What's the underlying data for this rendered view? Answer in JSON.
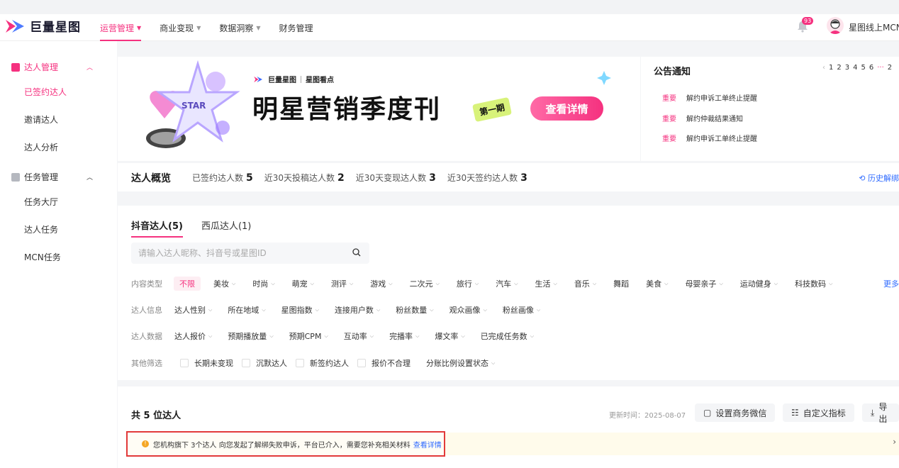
{
  "app": {
    "logo_text": "巨量星图"
  },
  "nav": [
    {
      "label": "运营管理",
      "active": true,
      "dropdown": true
    },
    {
      "label": "商业变现",
      "dropdown": true
    },
    {
      "label": "数据洞察",
      "dropdown": true
    },
    {
      "label": "财务管理",
      "dropdown": false
    }
  ],
  "header": {
    "notification_count": "93",
    "username": "星图线上MCN"
  },
  "sidebar": {
    "groups": [
      {
        "label": "达人管理",
        "items": [
          "已签约达人",
          "邀请达人",
          "达人分析"
        ]
      },
      {
        "label": "任务管理",
        "items": [
          "任务大厅",
          "达人任务",
          "MCN任务"
        ]
      }
    ]
  },
  "banner": {
    "brand": "巨量星图",
    "subbrand": "星图看点",
    "title": "明星营销季度刊",
    "tag": "第一期",
    "star": "STAR",
    "cta": "查看详情"
  },
  "notice": {
    "title": "公告通知",
    "pages": [
      "1",
      "2",
      "3",
      "4",
      "5",
      "6",
      "···",
      "2"
    ],
    "items": [
      {
        "tag": "重要",
        "text": "解约申诉工单终止提醒"
      },
      {
        "tag": "重要",
        "text": "解约仲裁结果通知"
      },
      {
        "tag": "重要",
        "text": "解约申诉工单终止提醒"
      }
    ]
  },
  "overview": {
    "title": "达人概览",
    "stats": [
      {
        "label": "已签约达人数",
        "value": "5"
      },
      {
        "label": "近30天投稿达人数",
        "value": "2"
      },
      {
        "label": "近30天变现达人数",
        "value": "3"
      },
      {
        "label": "近30天签约达人数",
        "value": "3"
      }
    ],
    "history": "历史解绑"
  },
  "tabs": [
    "抖音达人(5)",
    "西瓜达人(1)"
  ],
  "search": {
    "placeholder": "请输入达人昵称、抖音号或星图ID",
    "value": ""
  },
  "filters": {
    "content": {
      "label": "内容类型",
      "options": [
        "不限",
        "美妆",
        "时尚",
        "萌宠",
        "测评",
        "游戏",
        "二次元",
        "旅行",
        "汽车",
        "生活",
        "音乐",
        "舞蹈",
        "美食",
        "母婴亲子",
        "运动健身",
        "科技数码"
      ],
      "more": "更多"
    },
    "info": {
      "label": "达人信息",
      "options": [
        "达人性别",
        "所在地域",
        "星图指数",
        "连接用户数",
        "粉丝数量",
        "观众画像",
        "粉丝画像"
      ]
    },
    "data": {
      "label": "达人数据",
      "options": [
        "达人报价",
        "预期播放量",
        "预期CPM",
        "互动率",
        "完播率",
        "爆文率",
        "已完成任务数"
      ]
    },
    "other": {
      "label": "其他筛选",
      "checks": [
        "长期未变现",
        "沉默达人",
        "新签约达人",
        "报价不合理"
      ],
      "extra": "分账比例设置状态"
    }
  },
  "results": {
    "title": "共 5 位达人",
    "update": "更新时间：2025-08-07",
    "actions": [
      "设置商务微信",
      "自定义指标",
      "导出"
    ],
    "alert": {
      "text": "您机构旗下 3个达人 向您发起了解绑失败申诉，平台已介入，需要您补充相关材料",
      "link": "查看详情"
    }
  },
  "colors": {
    "accent": "#f5317f",
    "link": "#2f6bff",
    "alert_border": "#e23a3a"
  }
}
